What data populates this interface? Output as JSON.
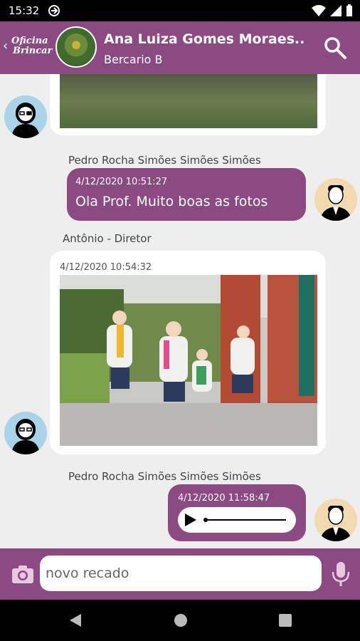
{
  "status_bar": {
    "time": "15:32"
  },
  "header": {
    "back_logo_line1": "Oficina",
    "back_logo_line2": "Brincar",
    "contact_name": "Ana Luiza Gomes Moraes..",
    "group": "Bercario B"
  },
  "messages": [
    {
      "sender": "Pedro Rocha Simões Simões Simões",
      "timestamp": "4/12/2020 10:51:27",
      "text": "Ola Prof. Muito boas as fotos"
    },
    {
      "sender": "Antônio - Diretor",
      "timestamp": "4/12/2020 10:54:32"
    },
    {
      "sender": "Pedro Rocha Simões Simões Simões",
      "timestamp": "4/12/2020 11:58:47"
    }
  ],
  "composer": {
    "placeholder": "novo recado"
  },
  "colors": {
    "primary": "#8b4a82",
    "background": "#eeeeee"
  },
  "icons": {
    "search": "search-icon",
    "camera": "camera-icon",
    "mic": "microphone-icon"
  }
}
